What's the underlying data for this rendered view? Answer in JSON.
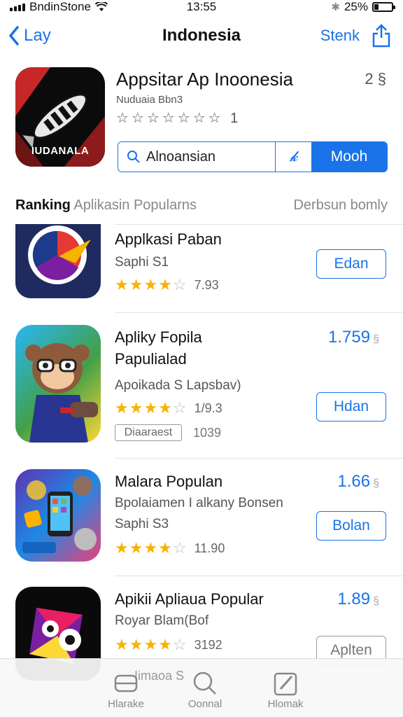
{
  "status_bar": {
    "carrier": "BndinStone",
    "time": "13:55",
    "battery": "25%",
    "battery_level": 0.25
  },
  "nav": {
    "back_label": "Lay",
    "title": "Indonesia",
    "right_label": "Stenk"
  },
  "featured": {
    "title": "Appsitar Ap Inoonesia",
    "count": "2 §",
    "subtitle": "Nuduaia Bbn3",
    "stars_text": "☆☆☆☆☆☆☆ 1",
    "icon_text": "IUDANALA",
    "search": {
      "value": "Alnoansian",
      "mid_icon": "k-icon",
      "button": "Mooh"
    }
  },
  "section": {
    "title_bold": "Ranking",
    "title_rest": "Aplikasin Popularns",
    "link": "Derbsun bomly"
  },
  "apps": [
    {
      "name_lines": [
        "Applkasi Paban"
      ],
      "sub": "Saphi S1",
      "rating": "7.93",
      "stars": 4.5,
      "button": "Edan",
      "price": "",
      "colors": [
        "#1f2b5e",
        "#e53935"
      ]
    },
    {
      "name_lines": [
        "Apliky Fopila",
        "Papulialad"
      ],
      "sub": "Apoikada S Lapsbav)",
      "rating": "1/9.3",
      "stars": 4.5,
      "button": "Hdan",
      "price": "1.759",
      "tag": "Diaaraest",
      "tag_count": "1039"
    },
    {
      "name_lines": [
        "Malara Populan"
      ],
      "sub": "Bpolaiamen I alkany Bonsen",
      "sub2": "Saphi S3",
      "rating": "11.90",
      "stars": 4.5,
      "button": "Bolan",
      "price": "1.66"
    },
    {
      "name_lines": [
        "Apikii Apliaua Popular"
      ],
      "sub": "Royar Blam(Bof",
      "rating": "3192",
      "stars": 4.5,
      "button": "Aplten",
      "price": "1.89"
    }
  ],
  "tab_bar": {
    "overlay_text": "Iimaoa S",
    "tabs": [
      {
        "label": "Hlarake",
        "icon": "stack-icon"
      },
      {
        "label": "Oonnal",
        "icon": "search-icon"
      },
      {
        "label": "Hlomak",
        "icon": "edit-icon"
      }
    ]
  }
}
